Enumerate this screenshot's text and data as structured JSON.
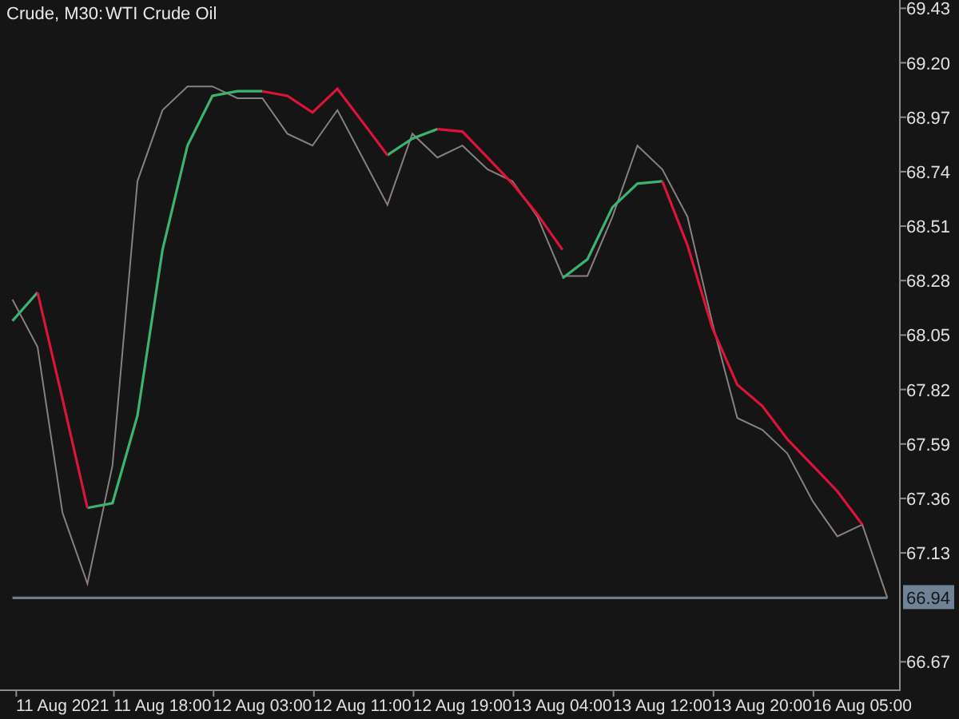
{
  "header": {
    "symbol": "Crude, M30:"
  },
  "chart": {
    "chart_data": {
      "type": "line",
      "title": "WTI Crude Oil",
      "categories": [
        null,
        null,
        "11 Aug 2021",
        null,
        null,
        null,
        "11 Aug 18:00",
        null,
        null,
        null,
        "12 Aug 03:00",
        null,
        null,
        null,
        "12 Aug 11:00",
        null,
        null,
        null,
        "12 Aug 19:00",
        null,
        null,
        null,
        "13 Aug 04:00",
        null,
        null,
        null,
        "13 Aug 12:00",
        null,
        null,
        null,
        "13 Aug 20:00",
        null,
        null,
        null,
        "16 Aug 05:00",
        null
      ],
      "ylim": [
        66.55,
        69.465
      ],
      "yticks": [
        {
          "value": 69.43,
          "label": "69.43"
        },
        {
          "value": 69.2,
          "label": "69.20"
        },
        {
          "value": 68.97,
          "label": "68.97"
        },
        {
          "value": 68.74,
          "label": "68.74"
        },
        {
          "value": 68.51,
          "label": "68.51"
        },
        {
          "value": 68.28,
          "label": "68.28"
        },
        {
          "value": 68.05,
          "label": "68.05"
        },
        {
          "value": 67.82,
          "label": "67.82"
        },
        {
          "value": 67.59,
          "label": "67.59"
        },
        {
          "value": 67.36,
          "label": "67.36"
        },
        {
          "value": 67.13,
          "label": "67.13"
        },
        {
          "value": 66.67,
          "label": "66.67"
        }
      ],
      "series": [
        {
          "color": "#8a7f80",
          "values": [
            68.2,
            68.0,
            67.3,
            67.0,
            67.5,
            68.7,
            69.0,
            69.1,
            69.1,
            69.05,
            69.05,
            68.9,
            68.85,
            69.0,
            68.8,
            68.6,
            68.9,
            68.8,
            68.85,
            68.75,
            68.7,
            68.55,
            68.3,
            68.3,
            68.55,
            68.85,
            68.75,
            68.55,
            68.1,
            67.7,
            67.65,
            67.55,
            67.35,
            67.2,
            67.25,
            66.94
          ]
        },
        {
          "color": "#3cb371",
          "values": [
            68.11,
            68.23,
            null,
            67.32,
            67.34,
            67.71,
            68.41,
            68.85,
            69.06,
            69.08,
            69.08,
            null,
            null,
            null,
            null,
            68.81,
            68.88,
            68.92,
            null,
            null,
            null,
            null,
            68.29,
            68.37,
            68.59,
            68.69,
            68.7,
            null,
            null,
            null,
            null,
            null,
            null,
            null,
            null,
            null
          ]
        },
        {
          "color": "#dc143c",
          "values": [
            null,
            68.23,
            67.78,
            67.32,
            null,
            null,
            null,
            null,
            null,
            null,
            69.08,
            69.06,
            68.99,
            69.09,
            68.95,
            68.81,
            null,
            68.92,
            68.91,
            68.8,
            68.69,
            68.56,
            68.41,
            null,
            null,
            null,
            68.7,
            68.43,
            68.08,
            67.84,
            67.75,
            67.61,
            67.5,
            67.39,
            67.25,
            null
          ]
        },
        {
          "color": "#6b7c8c",
          "values": [
            66.94,
            66.94,
            66.94,
            66.94,
            66.94,
            66.94,
            66.94,
            66.94,
            66.94,
            66.94,
            66.94,
            66.94,
            66.94,
            66.94,
            66.94,
            66.94,
            66.94,
            66.94,
            66.94,
            66.94,
            66.94,
            66.94,
            66.94,
            66.94,
            66.94,
            66.94,
            66.94,
            66.94,
            66.94,
            66.94,
            66.94,
            66.94,
            66.94,
            66.94,
            66.94,
            66.94
          ]
        }
      ]
    },
    "current_price_tag": {
      "label": "66.94"
    }
  }
}
